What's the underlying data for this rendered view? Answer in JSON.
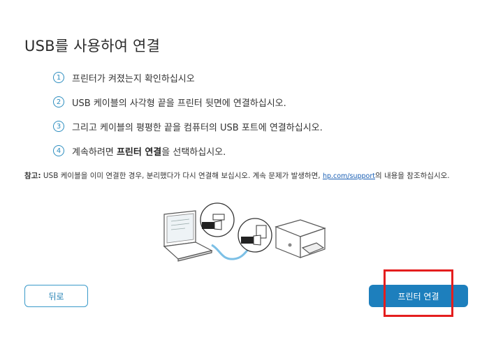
{
  "page": {
    "title": "USB를 사용하여 연결"
  },
  "steps": [
    {
      "num": "1",
      "text": "프린터가 켜졌는지 확인하십시오"
    },
    {
      "num": "2",
      "text": "USB 케이블의 사각형 끝을 프린터 뒷면에 연결하십시오."
    },
    {
      "num": "3",
      "text": "그리고 케이블의 평평한 끝을 컴퓨터의 USB 포트에 연결하십시오."
    },
    {
      "num": "4",
      "text_before": "계속하려면 ",
      "text_bold": "프린터 연결",
      "text_after": "을 선택하십시오."
    }
  ],
  "note": {
    "label": "참고:",
    "text_before": " USB 케이블을 이미 연결한 경우, 분리했다가 다시 연결해 보십시오. 계속 문제가 발생하면, ",
    "link": "hp.com/support",
    "text_after": "의 내용을 참조하십시오."
  },
  "buttons": {
    "back_label": "뒤로",
    "connect_label": "프린터 연결"
  },
  "colors": {
    "accent": "#1d7fbd",
    "outline": "#3a9ac9",
    "highlight": "#e41e1e"
  }
}
